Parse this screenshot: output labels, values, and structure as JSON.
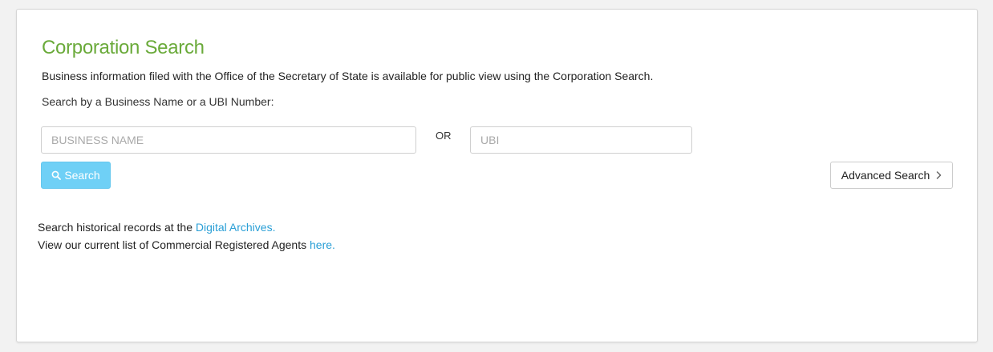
{
  "header": {
    "title": "Corporation Search",
    "intro": "Business information filed with the Office of the Secretary of State is available for public view using the Corporation Search.",
    "prompt": "Search by a Business Name or a UBI Number:"
  },
  "search": {
    "business_name_placeholder": "BUSINESS NAME",
    "or_label": "OR",
    "ubi_placeholder": "UBI",
    "search_label": "Search",
    "advanced_label": "Advanced Search"
  },
  "footer": {
    "archives_text": "Search historical records at the ",
    "archives_link": "Digital Archives.",
    "agents_text": "View our current list of Commercial Registered Agents ",
    "agents_link": "here."
  },
  "colors": {
    "title_green": "#6aaa3a",
    "search_button": "#6fd0f6",
    "link_blue": "#2a9fd6"
  },
  "icons": {
    "search_button_icon": "search-icon",
    "advanced_button_icon": "chevron-right-icon"
  }
}
